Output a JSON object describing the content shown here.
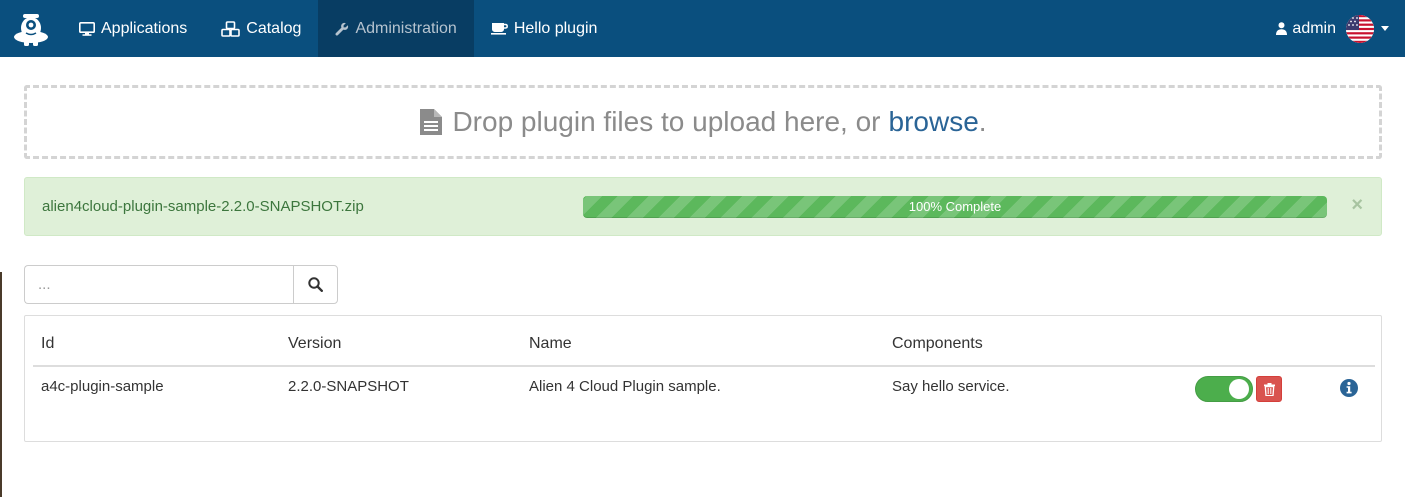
{
  "nav": {
    "logo_icon": "alien-mascot-icon",
    "items": [
      {
        "label": "Applications",
        "icon": "desktop-icon"
      },
      {
        "label": "Catalog",
        "icon": "cubes-icon"
      },
      {
        "label": "Administration",
        "icon": "wrench-icon",
        "active": true
      },
      {
        "label": "Hello plugin",
        "icon": "coffee-icon"
      }
    ],
    "user": {
      "label": "admin",
      "icon": "user-icon",
      "locale_icon": "us-flag-icon"
    }
  },
  "dropzone": {
    "icon": "file-icon",
    "text": "Drop plugin files to upload here, or",
    "link": "browse",
    "suffix": "."
  },
  "upload": {
    "file_name": "alien4cloud-plugin-sample-2.2.0-SNAPSHOT.zip",
    "progress_percent": 100,
    "progress_label": "100% Complete",
    "close_label": "×"
  },
  "search": {
    "placeholder": "...",
    "icon": "search-icon"
  },
  "table": {
    "headers": {
      "id": "Id",
      "version": "Version",
      "name": "Name",
      "components": "Components"
    },
    "rows": [
      {
        "id": "a4c-plugin-sample",
        "version": "2.2.0-SNAPSHOT",
        "name": "Alien 4 Cloud Plugin sample.",
        "components": "Say hello service.",
        "enabled": true
      }
    ]
  },
  "colors": {
    "navbar": "#0a4f7e",
    "navbar_active": "#083d63",
    "success_bg": "#dff0d8",
    "success_text": "#3c763d",
    "progress": "#5cb85c",
    "toggle_on": "#4cae4c",
    "danger": "#d9534f",
    "link": "#2a6496",
    "info": "#2a6496"
  }
}
